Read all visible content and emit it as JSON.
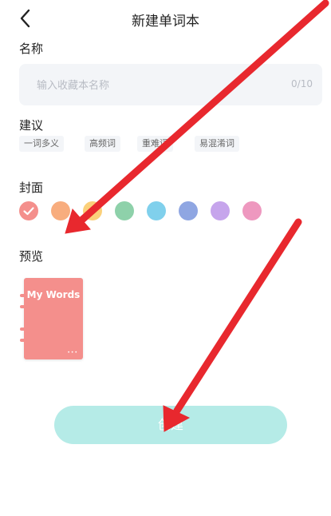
{
  "header": {
    "title": "新建单词本",
    "back_icon": "chevron-left-icon"
  },
  "name_section": {
    "label": "名称",
    "placeholder": "输入收藏本名称",
    "value": "",
    "counter": "0/10"
  },
  "suggest_section": {
    "label": "建议",
    "chips": [
      "一词多义",
      "高频词",
      "重难词",
      "易混淆词"
    ]
  },
  "cover_section": {
    "label": "封面",
    "colors": [
      "#f48f8c",
      "#f8ad7e",
      "#fbd07a",
      "#8ed1aa",
      "#80d0ec",
      "#8fa6e2",
      "#c6a5ec",
      "#ee98bf"
    ],
    "selected_index": 0,
    "check_icon": "check-icon"
  },
  "preview_section": {
    "label": "预览",
    "book_title": "My Words",
    "book_color": "#f48f8c"
  },
  "create_button": {
    "label": "创建",
    "color": "#b5ebe7"
  },
  "annotation_color": "#e8282e"
}
